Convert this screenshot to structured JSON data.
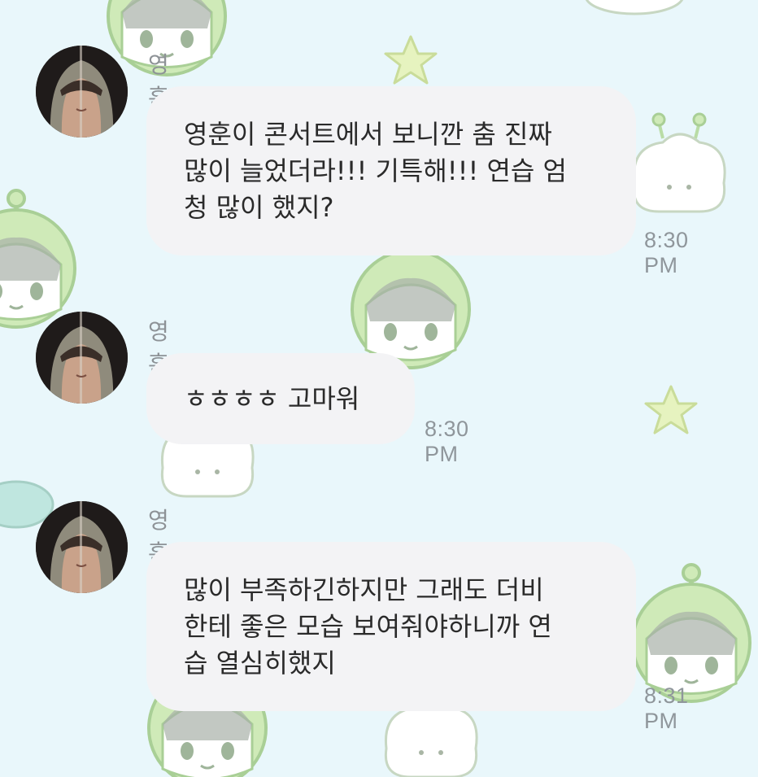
{
  "chat": {
    "messages": [
      {
        "sender": "영훈이",
        "text": "영훈이 콘서트에서 보니깐 춤 진짜\n많이 늘었더라!!! 기특해!!! 연습 엄\n청 많이 했지?",
        "time": "8:30 PM"
      },
      {
        "sender": "영훈이",
        "text": "ㅎㅎㅎㅎ 고마워",
        "time": "8:30 PM"
      },
      {
        "sender": "영훈이",
        "text": "많이 부족하긴하지만 그래도 더비\n한테 좋은 모습 보여줘야하니까 연\n습 열심히했지",
        "time": "8:31 PM"
      }
    ]
  },
  "theme": {
    "background": "#e9f7fb",
    "bubble": "#f3f3f5",
    "pattern_green": "#cfeab8",
    "pattern_star": "#e6f3bf"
  },
  "icons": [
    "avatar-photo",
    "alien-pattern",
    "star-pattern"
  ]
}
